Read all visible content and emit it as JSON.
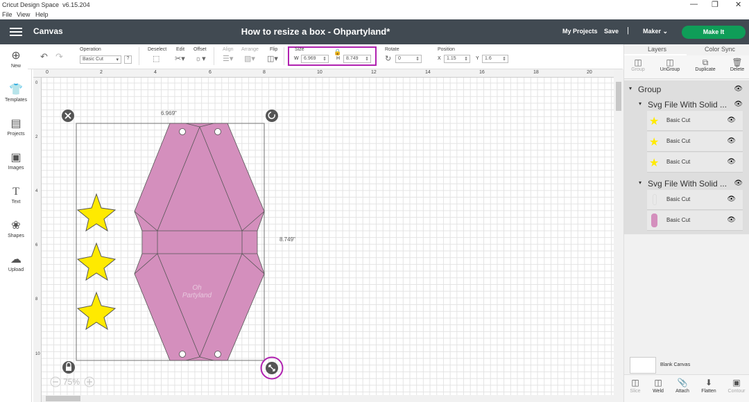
{
  "window": {
    "app_title": "Cricut Design Space",
    "version": "v6.15.204",
    "menu": [
      "File",
      "View",
      "Help"
    ],
    "controls": {
      "minimize": "—",
      "restore": "❐",
      "close": "✕"
    }
  },
  "header": {
    "canvas_label": "Canvas",
    "project_title": "How to resize a box - Ohpartyland*",
    "my_projects": "My Projects",
    "save": "Save",
    "separator": "|",
    "machine": "Maker",
    "make_it": "Make It"
  },
  "toolbar": {
    "operation": {
      "label": "Operation",
      "value": "Basic Cut",
      "help": "?"
    },
    "deselect": "Deselect",
    "edit": "Edit",
    "offset": "Offset",
    "align": "Align",
    "arrange": "Arrange",
    "flip": "Flip",
    "size": {
      "label": "Size",
      "w_label": "W",
      "w_value": "6.969",
      "h_label": "H",
      "h_value": "8.749"
    },
    "rotate": {
      "label": "Rotate",
      "value": "0"
    },
    "position": {
      "label": "Position",
      "x_label": "X",
      "x_value": "1.15",
      "y_label": "Y",
      "y_value": "1.6"
    }
  },
  "left_rail": [
    {
      "label": "New",
      "icon": "plus-icon"
    },
    {
      "label": "Templates",
      "icon": "shirt-icon"
    },
    {
      "label": "Projects",
      "icon": "projects-icon"
    },
    {
      "label": "Images",
      "icon": "image-icon"
    },
    {
      "label": "Text",
      "icon": "text-icon"
    },
    {
      "label": "Shapes",
      "icon": "shapes-icon"
    },
    {
      "label": "Upload",
      "icon": "upload-icon"
    }
  ],
  "ruler": {
    "top": [
      "0",
      "2",
      "4",
      "6",
      "8",
      "10",
      "12",
      "14",
      "16",
      "18",
      "20"
    ],
    "left": [
      "0",
      "2",
      "4",
      "6",
      "8",
      "10"
    ]
  },
  "canvas": {
    "width_label": "6.969\"",
    "height_label": "8.749\"",
    "zoom": "75%",
    "watermark": "Oh Partyland"
  },
  "panel": {
    "tabs": [
      "Layers",
      "Color Sync"
    ],
    "actions": [
      "Group",
      "UnGroup",
      "Duplicate",
      "Delete"
    ],
    "tree": {
      "group": "Group",
      "sub1": "Svg File With Solid ...",
      "sub1_items": [
        "Basic Cut",
        "Basic Cut",
        "Basic Cut"
      ],
      "sub2": "Svg File With Solid ...",
      "sub2_items": [
        "Basic Cut",
        "Basic Cut"
      ]
    },
    "blank_canvas": "Blank Canvas",
    "bottom": [
      "Slice",
      "Weld",
      "Attach",
      "Flatten",
      "Contour"
    ]
  },
  "colors": {
    "header": "#414a52",
    "make_it": "#0f9d58",
    "highlight": "#b021b0",
    "box_fill": "#d48fbd",
    "star": "#ffea00"
  }
}
